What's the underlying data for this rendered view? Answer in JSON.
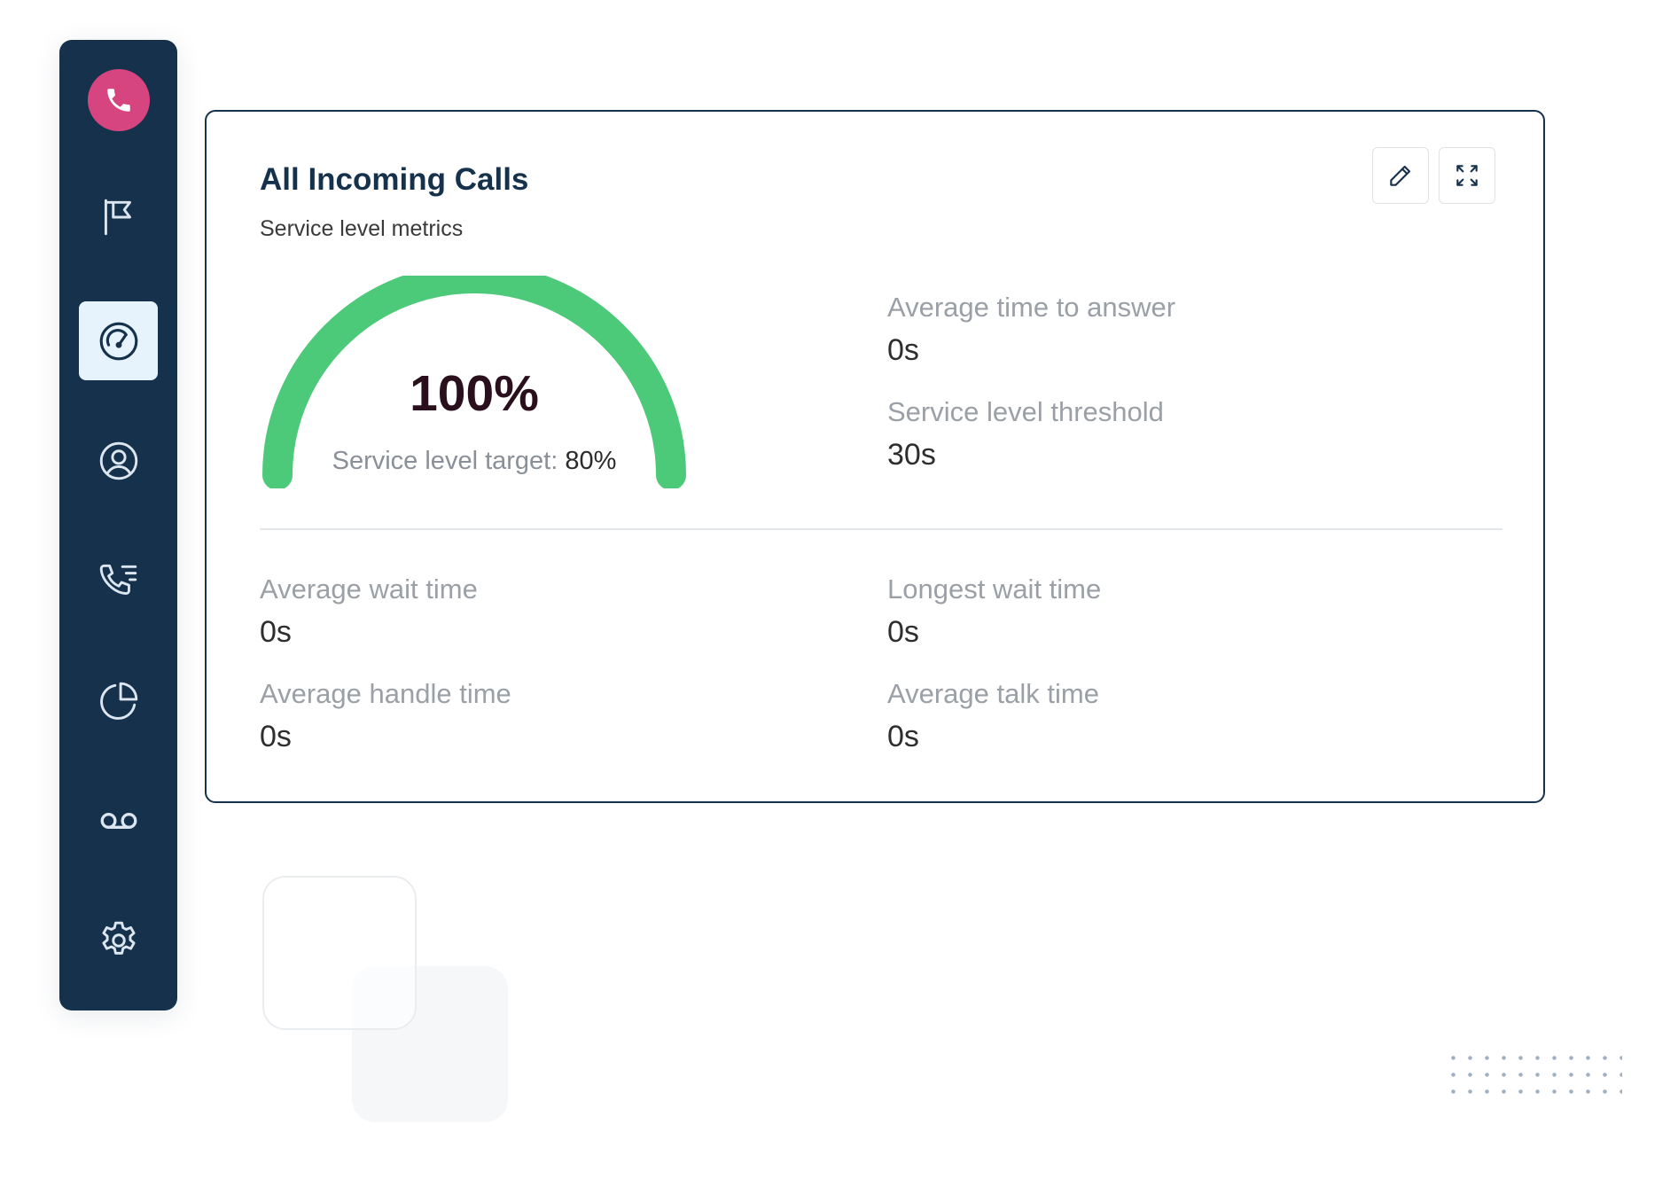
{
  "sidebar": {
    "logo_icon": "phone-icon",
    "brand_color": "#d6457f",
    "background_color": "#16314b",
    "active_color": "#e6f2fc",
    "items": [
      {
        "icon": "flag-icon",
        "active": false
      },
      {
        "icon": "speedometer-icon",
        "active": true
      },
      {
        "icon": "user-circle-icon",
        "active": false
      },
      {
        "icon": "phone-list-icon",
        "active": false
      },
      {
        "icon": "pie-chart-icon",
        "active": false
      },
      {
        "icon": "voicemail-icon",
        "active": false
      },
      {
        "icon": "gear-icon",
        "active": false
      }
    ]
  },
  "card": {
    "title": "All Incoming Calls",
    "subtitle": "Service level metrics",
    "edit_icon": "pencil-icon",
    "expand_icon": "expand-icon",
    "gauge": {
      "value_label": "100%",
      "fraction": 1.0,
      "color": "#4cca79",
      "target_label": "Service level target:",
      "target_value": "80%"
    },
    "metrics_top": [
      {
        "label": "Average time to answer",
        "value": "0s"
      },
      {
        "label": "Service level threshold",
        "value": "30s"
      }
    ],
    "metrics_bottom": [
      {
        "label": "Average wait time",
        "value": "0s"
      },
      {
        "label": "Longest wait time",
        "value": "0s"
      },
      {
        "label": "Average handle time",
        "value": "0s"
      },
      {
        "label": "Average talk time",
        "value": "0s"
      }
    ]
  }
}
